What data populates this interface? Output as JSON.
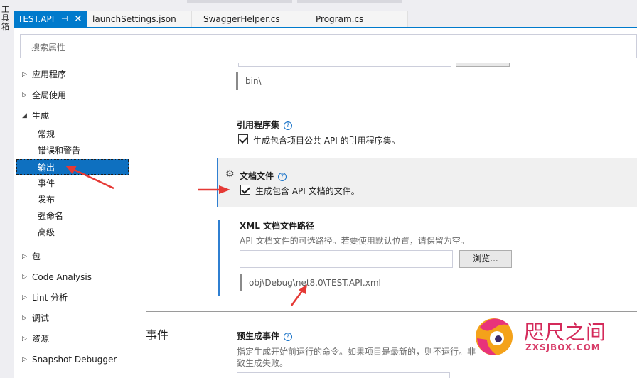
{
  "toolbox": {
    "label": "工具箱"
  },
  "tabs": [
    {
      "label": "TEST.API",
      "active": true
    },
    {
      "label": "launchSettings.json",
      "active": false
    },
    {
      "label": "SwaggerHelper.cs",
      "active": false
    },
    {
      "label": "Program.cs",
      "active": false
    }
  ],
  "search": {
    "placeholder": "搜索属性"
  },
  "nav": {
    "items": [
      {
        "label": "应用程序",
        "expanded": false
      },
      {
        "label": "全局使用",
        "expanded": false
      },
      {
        "label": "生成",
        "expanded": true
      },
      {
        "label": "常规"
      },
      {
        "label": "错误和警告"
      },
      {
        "label": "输出",
        "selected": true
      },
      {
        "label": "事件"
      },
      {
        "label": "发布"
      },
      {
        "label": "强命名"
      },
      {
        "label": "高级"
      },
      {
        "label": "包",
        "expanded": false
      },
      {
        "label": "Code Analysis",
        "expanded": false
      },
      {
        "label": "Lint 分析",
        "expanded": false
      },
      {
        "label": "调试",
        "expanded": false
      },
      {
        "label": "资源",
        "expanded": false
      },
      {
        "label": "Snapshot Debugger",
        "expanded": false
      }
    ]
  },
  "content": {
    "output_path_value": "bin\\",
    "ref_assembly": {
      "title": "引用程序集",
      "checkbox_label": "生成包含项目公共 API 的引用程序集。",
      "checked": true
    },
    "doc_file": {
      "title": "文档文件",
      "checkbox_label": "生成包含 API 文档的文件。",
      "checked": true
    },
    "xml_path": {
      "title": "XML 文档文件路径",
      "description": "API 文档文件的可选路径。若要使用默认位置，请保留为空。",
      "value": "",
      "browse_label": "浏览...",
      "resolved_path": "obj\\Debug\\net8.0\\TEST.API.xml"
    },
    "events_heading": "事件",
    "pre_build": {
      "title": "预生成事件",
      "description_line1": "指定生成开始前运行的命令。如果项目是最新的，则不运行。非",
      "description_line2": "致生成失败。"
    },
    "help_glyph": "?"
  },
  "watermark": {
    "cn": "咫尺之间",
    "en": "ZXSJBOX.COM"
  },
  "colors": {
    "accent": "#007acc",
    "selection": "#0e70c0",
    "arrow": "#e53935",
    "watermark": "#d42a5a"
  }
}
